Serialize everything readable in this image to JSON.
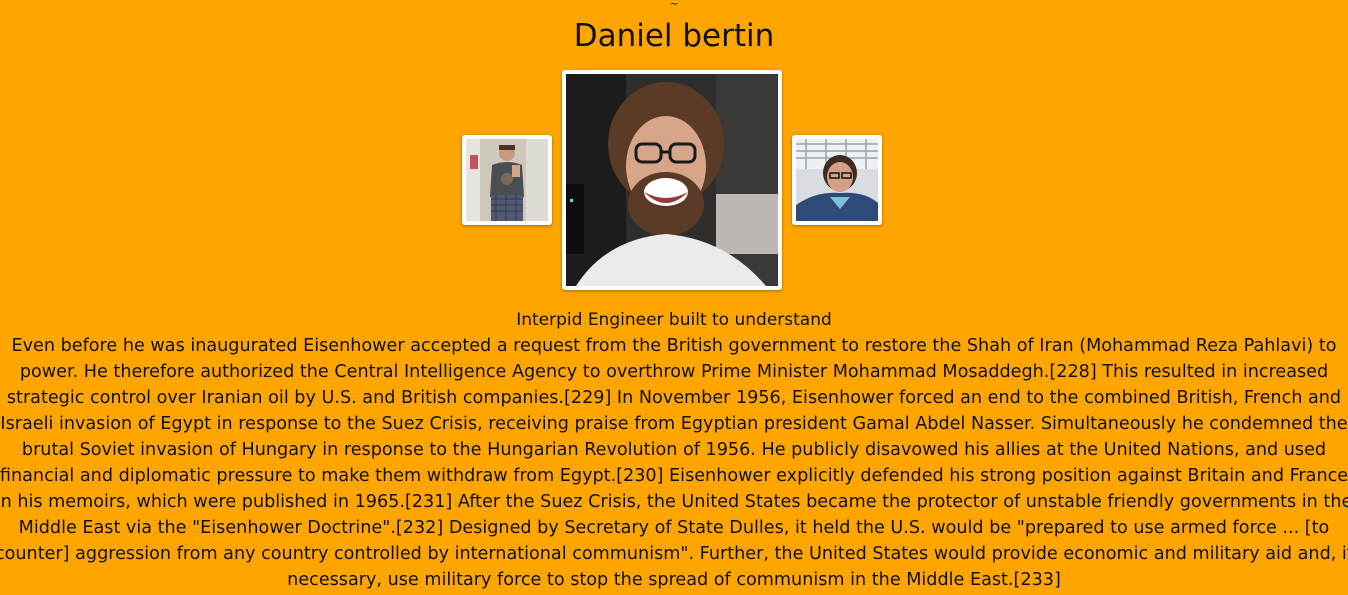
{
  "header": {
    "tilde": "~",
    "name": "Daniel bertin"
  },
  "gallery": {
    "images": [
      {
        "icon": "portrait-photo-full-body",
        "role": "previous"
      },
      {
        "icon": "portrait-photo-smiling-glasses",
        "role": "current"
      },
      {
        "icon": "portrait-photo-selfie",
        "role": "next"
      }
    ]
  },
  "profile": {
    "tagline": "Interpid Engineer built to understand",
    "bio": "Even before he was inaugurated Eisenhower accepted a request from the British government to restore the Shah of Iran (Mohammad Reza Pahlavi) to power. He therefore authorized the Central Intelligence Agency to overthrow Prime Minister Mohammad Mosaddegh.[228] This resulted in increased strategic control over Iranian oil by U.S. and British companies.[229] In November 1956, Eisenhower forced an end to the combined British, French and Israeli invasion of Egypt in response to the Suez Crisis, receiving praise from Egyptian president Gamal Abdel Nasser. Simultaneously he condemned the brutal Soviet invasion of Hungary in response to the Hungarian Revolution of 1956. He publicly disavowed his allies at the United Nations, and used financial and diplomatic pressure to make them withdraw from Egypt.[230] Eisenhower explicitly defended his strong position against Britain and France in his memoirs, which were published in 1965.[231] After the Suez Crisis, the United States became the protector of unstable friendly governments in the Middle East via the \"Eisenhower Doctrine\".[232] Designed by Secretary of State Dulles, it held the U.S. would be \"prepared to use armed force ... [to counter] aggression from any country controlled by international communism\". Further, the United States would provide economic and military aid and, if necessary, use military force to stop the spread of communism in the Middle East.[233]"
  },
  "colors": {
    "background": "#FFA500",
    "text": "#111111",
    "photo_frame": "#FFFFFF"
  }
}
